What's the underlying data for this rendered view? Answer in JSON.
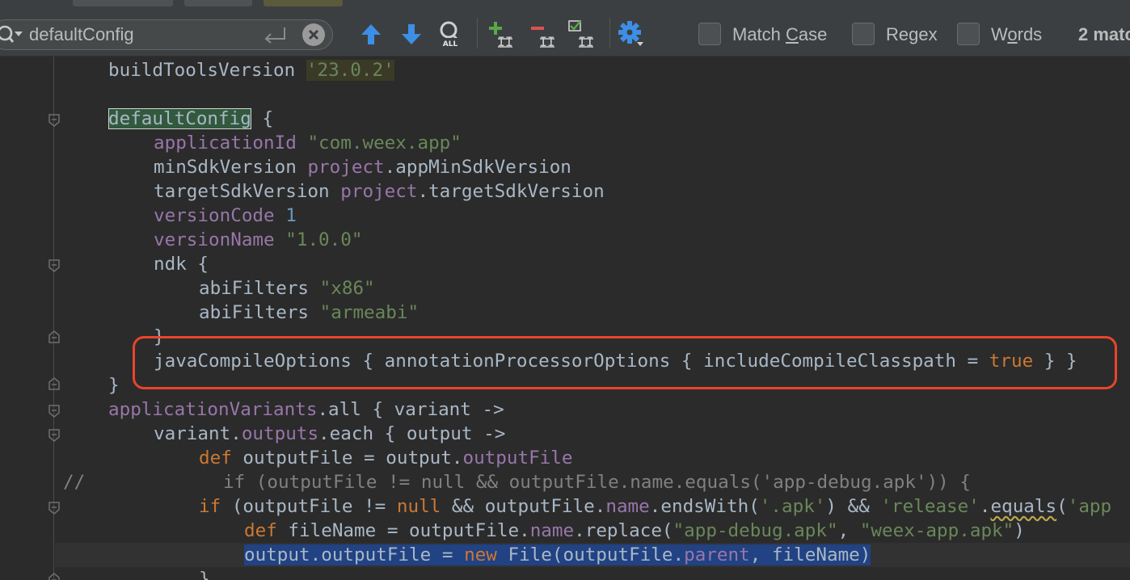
{
  "search": {
    "query": "defaultConfig",
    "match_count": "2 matc"
  },
  "options": {
    "match_case": {
      "before": "Match ",
      "mnemonic": "C",
      "after": "ase"
    },
    "regex": {
      "before": "Re",
      "mnemonic": "g",
      "after": "ex"
    },
    "words": {
      "before": "W",
      "mnemonic": "o",
      "after": "rds"
    }
  },
  "toolbar_icons": {
    "previous": "arrow-up-icon",
    "next": "arrow-down-icon",
    "select_all": "select-all-occurrences-icon",
    "add_selection": "add-occurrence-icon",
    "remove_selection": "remove-occurrence-icon",
    "toggle_selection": "toggle-occurrence-icon",
    "settings": "gear-icon"
  },
  "colors": {
    "keyword": "#cc7832",
    "string": "#6a8759",
    "number": "#6897bb",
    "property": "#9876aa",
    "comment": "#808080",
    "text": "#a9b7c6",
    "background": "#2b2b2b",
    "callout": "#e8452c",
    "selection": "#214283",
    "search_hit": "#32593d"
  },
  "code": {
    "l1": {
      "a": "buildToolsVersion ",
      "b": "'23.0.2'"
    },
    "l3": {
      "a": "defaultConfig",
      "b": " {"
    },
    "l4": {
      "a": "applicationId",
      "b": " ",
      "c": "\"com.weex.app\""
    },
    "l5": {
      "a": "minSdkVersion ",
      "b": "project",
      "c": ".appMinSdkVersion"
    },
    "l6": {
      "a": "targetSdkVersion ",
      "b": "project",
      "c": ".targetSdkVersion"
    },
    "l7": {
      "a": "versionCode",
      "b": " ",
      "c": "1"
    },
    "l8": {
      "a": "versionName",
      "b": " ",
      "c": "\"1.0.0\""
    },
    "l9": {
      "a": "ndk {"
    },
    "l10": {
      "a": "abiFilters ",
      "b": "\"x86\""
    },
    "l11": {
      "a": "abiFilters ",
      "b": "\"armeabi\""
    },
    "l12": {
      "a": "}"
    },
    "l13": {
      "a": "javaCompileOptions { annotationProcessorOptions { includeCompileClasspath = ",
      "b": "true",
      "c": " } }"
    },
    "l14": {
      "a": "}"
    },
    "l15": {
      "a": "applicationVariants",
      "b": ".all { variant ->"
    },
    "l16": {
      "a": "variant.",
      "b": "outputs",
      "c": ".each { output ->"
    },
    "l17": {
      "a": "def",
      "b": " outputFile = output.",
      "c": "outputFile"
    },
    "l18": {
      "a": "//",
      "b": "if (outputFile != null && outputFile.name.equals('app-debug.apk')) {"
    },
    "l19": {
      "a": "if",
      "b": " (outputFile != ",
      "c": "null",
      "d": " && outputFile.",
      "e": "name",
      "f": ".endsWith(",
      "g": "'.apk'",
      "h": ") && ",
      "i": "'release'",
      "j": ".",
      "k": "equals",
      "l": "(",
      "m": "'app"
    },
    "l20": {
      "a": "def",
      "b": " fileName = outputFile.",
      "c": "name",
      "d": ".replace(",
      "e": "\"app-debug.apk\"",
      "f": ", ",
      "g": "\"weex-app.apk\"",
      "h": ")"
    },
    "l21": {
      "a": "output.outputFile = ",
      "b": "new",
      "c": " File(outputFile.",
      "d": "parent",
      "e": ", fileName)"
    },
    "l22": {
      "a": "}"
    }
  }
}
